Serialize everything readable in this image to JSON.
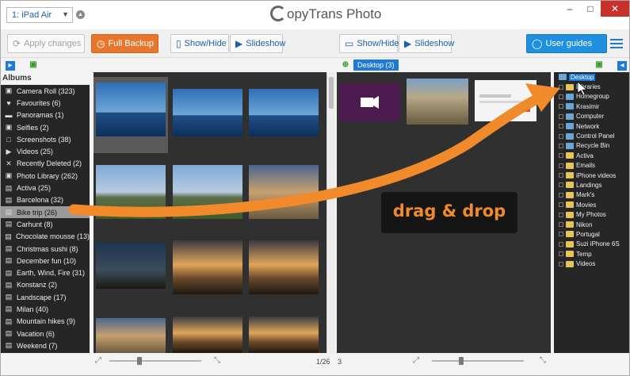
{
  "window": {
    "device_selector": "1: iPad Air",
    "app_title": "CopyTrans Photo",
    "app_title_c": "C",
    "app_title_rest": "opyTrans Photo"
  },
  "toolbar": {
    "apply_changes": "Apply changes",
    "full_backup": "Full Backup",
    "show_hide_left": "Show/Hide",
    "slideshow_left": "Slideshow",
    "show_hide_right": "Show/Hide",
    "slideshow_right": "Slideshow",
    "user_guides": "User guides"
  },
  "albums_header": "Albums",
  "albums": [
    {
      "label": "Camera Roll (323)",
      "icon": "camera-icon"
    },
    {
      "label": "Favourites (6)",
      "icon": "heart-icon"
    },
    {
      "label": "Panoramas (1)",
      "icon": "panorama-icon"
    },
    {
      "label": "Selfies (2)",
      "icon": "camera-icon"
    },
    {
      "label": "Screenshots (38)",
      "icon": "screenshot-icon"
    },
    {
      "label": "Videos (25)",
      "icon": "video-icon"
    },
    {
      "label": "Recently Deleted (2)",
      "icon": "trash-icon"
    },
    {
      "label": "Photo Library (262)",
      "icon": "camera-icon"
    },
    {
      "label": "Activa (25)",
      "icon": "album-icon"
    },
    {
      "label": "Barcelona (32)",
      "icon": "album-icon"
    },
    {
      "label": "Bike trip (26)",
      "icon": "album-icon",
      "selected": true
    },
    {
      "label": "Carhunt (8)",
      "icon": "album-icon"
    },
    {
      "label": "Chocolate mousse (13)",
      "icon": "album-icon"
    },
    {
      "label": "Christmas sushi (8)",
      "icon": "album-icon"
    },
    {
      "label": "December fun (10)",
      "icon": "album-icon"
    },
    {
      "label": "Earth, Wind, Fire (31)",
      "icon": "album-icon"
    },
    {
      "label": "Konstanz (2)",
      "icon": "album-icon"
    },
    {
      "label": "Landscape (17)",
      "icon": "album-icon"
    },
    {
      "label": "Milan (40)",
      "icon": "album-icon"
    },
    {
      "label": "Mountain hikes (9)",
      "icon": "album-icon"
    },
    {
      "label": "Vacation (6)",
      "icon": "album-icon"
    },
    {
      "label": "Weekend (7)",
      "icon": "album-icon"
    }
  ],
  "destination_tab": "Desktop (3)",
  "tree": [
    {
      "label": "Desktop",
      "root": true,
      "folder": "sys"
    },
    {
      "label": "Libraries",
      "folder": "folder"
    },
    {
      "label": "Homegroup",
      "folder": "sys"
    },
    {
      "label": "Krasimir",
      "folder": "sys"
    },
    {
      "label": "Computer",
      "folder": "sys"
    },
    {
      "label": "Network",
      "folder": "sys"
    },
    {
      "label": "Control Panel",
      "folder": "sys"
    },
    {
      "label": "Recycle Bin",
      "folder": "sys"
    },
    {
      "label": "Activa",
      "folder": "folder"
    },
    {
      "label": "Emails",
      "folder": "folder"
    },
    {
      "label": "iPhone videos",
      "folder": "folder"
    },
    {
      "label": "Landings",
      "folder": "folder"
    },
    {
      "label": "Mark's",
      "folder": "folder"
    },
    {
      "label": "Movies",
      "folder": "folder"
    },
    {
      "label": "My Photos",
      "folder": "folder"
    },
    {
      "label": "Nikon",
      "folder": "folder"
    },
    {
      "label": "Portugal",
      "folder": "folder"
    },
    {
      "label": "Suzi iPhone 6S",
      "folder": "folder"
    },
    {
      "label": "Temp",
      "folder": "folder"
    },
    {
      "label": "Videos",
      "folder": "folder"
    }
  ],
  "status": {
    "left_page": "1/26",
    "right_count": "3"
  },
  "overlay": {
    "drag_drop": "drag & drop"
  },
  "colors": {
    "accent_blue": "#1d7ad8",
    "backup_orange": "#e8772e",
    "arrow_orange": "#f08a2a",
    "panel_dark": "#303030"
  }
}
